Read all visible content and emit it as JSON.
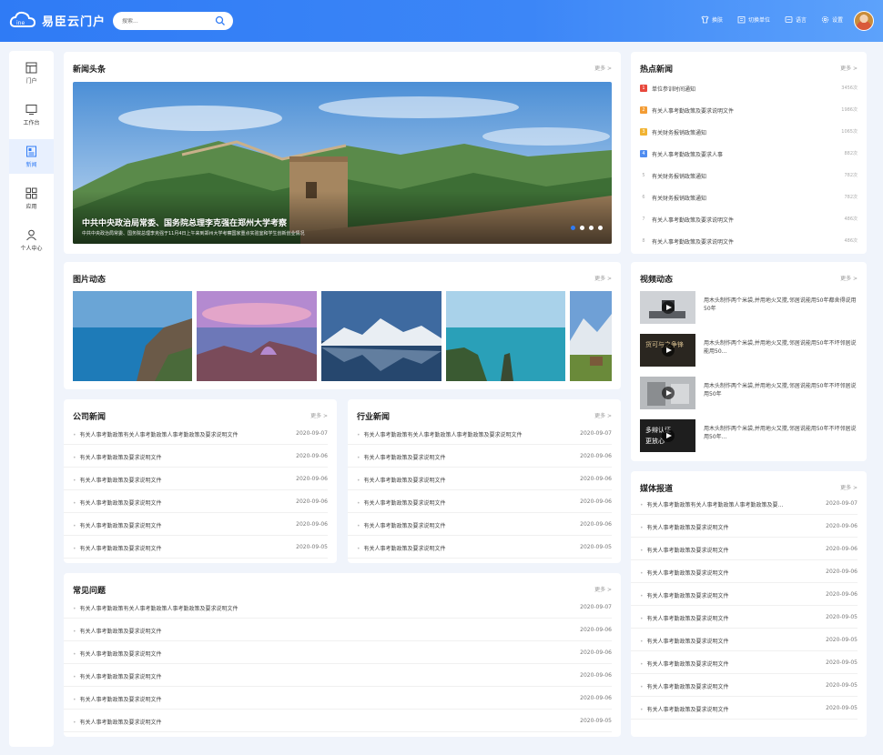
{
  "header": {
    "title": "易臣云门户",
    "search_placeholder": "搜索...",
    "nav": [
      "换肤",
      "切换单位",
      "语言",
      "设置"
    ]
  },
  "sidebar": {
    "items": [
      "门户",
      "工作台",
      "新闻",
      "应用",
      "个人中心"
    ]
  },
  "more_label": "更多 >",
  "headline": {
    "title": "新闻头条",
    "banner_caption": "中共中央政治局常委、国务院总理李克强在郑州大学考察",
    "banner_sub": "中共中央政治局常委、国务院总理李克强于11月4日上午来到郑州大学考察国家重点实验室和学生创新创业情况"
  },
  "hot": {
    "title": "热点新闻",
    "items": [
      {
        "rank": "1",
        "text": "单位参训时间通知",
        "count": "3456次"
      },
      {
        "rank": "2",
        "text": "有关人事考勤政策及要求说明文件",
        "count": "1986次"
      },
      {
        "rank": "3",
        "text": "有关财务报销政策通知",
        "count": "1065次"
      },
      {
        "rank": "4",
        "text": "有关人事考勤政策及要求人事",
        "count": "882次"
      },
      {
        "rank": "5",
        "text": "有关财务报销政策通知",
        "count": "782次"
      },
      {
        "rank": "6",
        "text": "有关财务报销政策通知",
        "count": "782次"
      },
      {
        "rank": "7",
        "text": "有关人事考勤政策及要求说明文件",
        "count": "486次"
      },
      {
        "rank": "8",
        "text": "有关人事考勤政策及要求说明文件",
        "count": "486次"
      }
    ]
  },
  "photos": {
    "title": "图片动态"
  },
  "video": {
    "title": "视频动态",
    "items": [
      {
        "text": "用木头制作两个米袋,并用地火又搅,邻居说能用50年都舍得说用50年"
      },
      {
        "text": "用木头制作两个米袋,并用地火又搅,邻居说能用50年不坏邻居说能用50..."
      },
      {
        "text": "用木头制作两个米袋,并用地火又搅,邻居说能用50年不坏邻居说用50年"
      },
      {
        "text": "用木头制作两个米袋,并用地火又搅,邻居说能用50年不坏邻居说用50年..."
      }
    ]
  },
  "company": {
    "title": "公司新闻",
    "items": [
      {
        "text": "有关人事考勤政策有关人事考勤政策人事考勤政策及要求说明文件",
        "date": "2020-09-07"
      },
      {
        "text": "有关人事考勤政策及要求说明文件",
        "date": "2020-09-06"
      },
      {
        "text": "有关人事考勤政策及要求说明文件",
        "date": "2020-09-06"
      },
      {
        "text": "有关人事考勤政策及要求说明文件",
        "date": "2020-09-06"
      },
      {
        "text": "有关人事考勤政策及要求说明文件",
        "date": "2020-09-06"
      },
      {
        "text": "有关人事考勤政策及要求说明文件",
        "date": "2020-09-05"
      }
    ]
  },
  "industry": {
    "title": "行业新闻",
    "items": [
      {
        "text": "有关人事考勤政策有关人事考勤政策人事考勤政策及要求说明文件",
        "date": "2020-09-07"
      },
      {
        "text": "有关人事考勤政策及要求说明文件",
        "date": "2020-09-06"
      },
      {
        "text": "有关人事考勤政策及要求说明文件",
        "date": "2020-09-06"
      },
      {
        "text": "有关人事考勤政策及要求说明文件",
        "date": "2020-09-06"
      },
      {
        "text": "有关人事考勤政策及要求说明文件",
        "date": "2020-09-06"
      },
      {
        "text": "有关人事考勤政策及要求说明文件",
        "date": "2020-09-05"
      }
    ]
  },
  "faq": {
    "title": "常见问题",
    "items": [
      {
        "text": "有关人事考勤政策有关人事考勤政策人事考勤政策及要求说明文件",
        "date": "2020-09-07"
      },
      {
        "text": "有关人事考勤政策及要求说明文件",
        "date": "2020-09-06"
      },
      {
        "text": "有关人事考勤政策及要求说明文件",
        "date": "2020-09-06"
      },
      {
        "text": "有关人事考勤政策及要求说明文件",
        "date": "2020-09-06"
      },
      {
        "text": "有关人事考勤政策及要求说明文件",
        "date": "2020-09-06"
      },
      {
        "text": "有关人事考勤政策及要求说明文件",
        "date": "2020-09-05"
      }
    ]
  },
  "media": {
    "title": "媒体报道",
    "items": [
      {
        "text": "有关人事考勤政策有关人事考勤政策人事考勤政策及要...",
        "date": "2020-09-07"
      },
      {
        "text": "有关人事考勤政策及要求说明文件",
        "date": "2020-09-06"
      },
      {
        "text": "有关人事考勤政策及要求说明文件",
        "date": "2020-09-06"
      },
      {
        "text": "有关人事考勤政策及要求说明文件",
        "date": "2020-09-06"
      },
      {
        "text": "有关人事考勤政策及要求说明文件",
        "date": "2020-09-06"
      },
      {
        "text": "有关人事考勤政策及要求说明文件",
        "date": "2020-09-05"
      },
      {
        "text": "有关人事考勤政策及要求说明文件",
        "date": "2020-09-05"
      },
      {
        "text": "有关人事考勤政策及要求说明文件",
        "date": "2020-09-05"
      },
      {
        "text": "有关人事考勤政策及要求说明文件",
        "date": "2020-09-05"
      },
      {
        "text": "有关人事考勤政策及要求说明文件",
        "date": "2020-09-05"
      }
    ]
  }
}
